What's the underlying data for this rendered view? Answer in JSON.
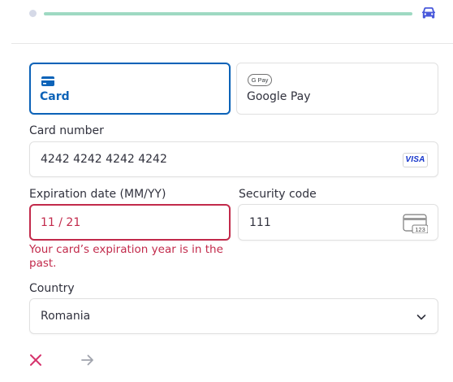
{
  "progress": {
    "track_color": "#9ed9c2",
    "vehicle_icon": "car-icon",
    "vehicle_color": "#4a5adb"
  },
  "payment_methods": [
    {
      "label": "Card",
      "icon": "credit-card-icon",
      "selected": true
    },
    {
      "label": "Google Pay",
      "badge": "G Pay",
      "icon": "google-pay-icon",
      "selected": false
    }
  ],
  "card_number": {
    "label": "Card number",
    "value": "4242 4242 4242 4242",
    "brand": "VISA"
  },
  "expiration": {
    "label": "Expiration date (MM/YY)",
    "value": "11 / 21",
    "state": "error",
    "error": "Your card’s expiration year is in the past."
  },
  "security_code": {
    "label": "Security code",
    "value": "111",
    "icon_text": "123"
  },
  "country": {
    "label": "Country",
    "value": "Romania"
  },
  "actions": {
    "cancel_icon": "close-icon",
    "next_icon": "arrow-right-icon"
  },
  "colors": {
    "accent": "#0d63b8",
    "error": "#c22a4b",
    "cancel": "#d6336c",
    "next": "#a0a4ad"
  }
}
